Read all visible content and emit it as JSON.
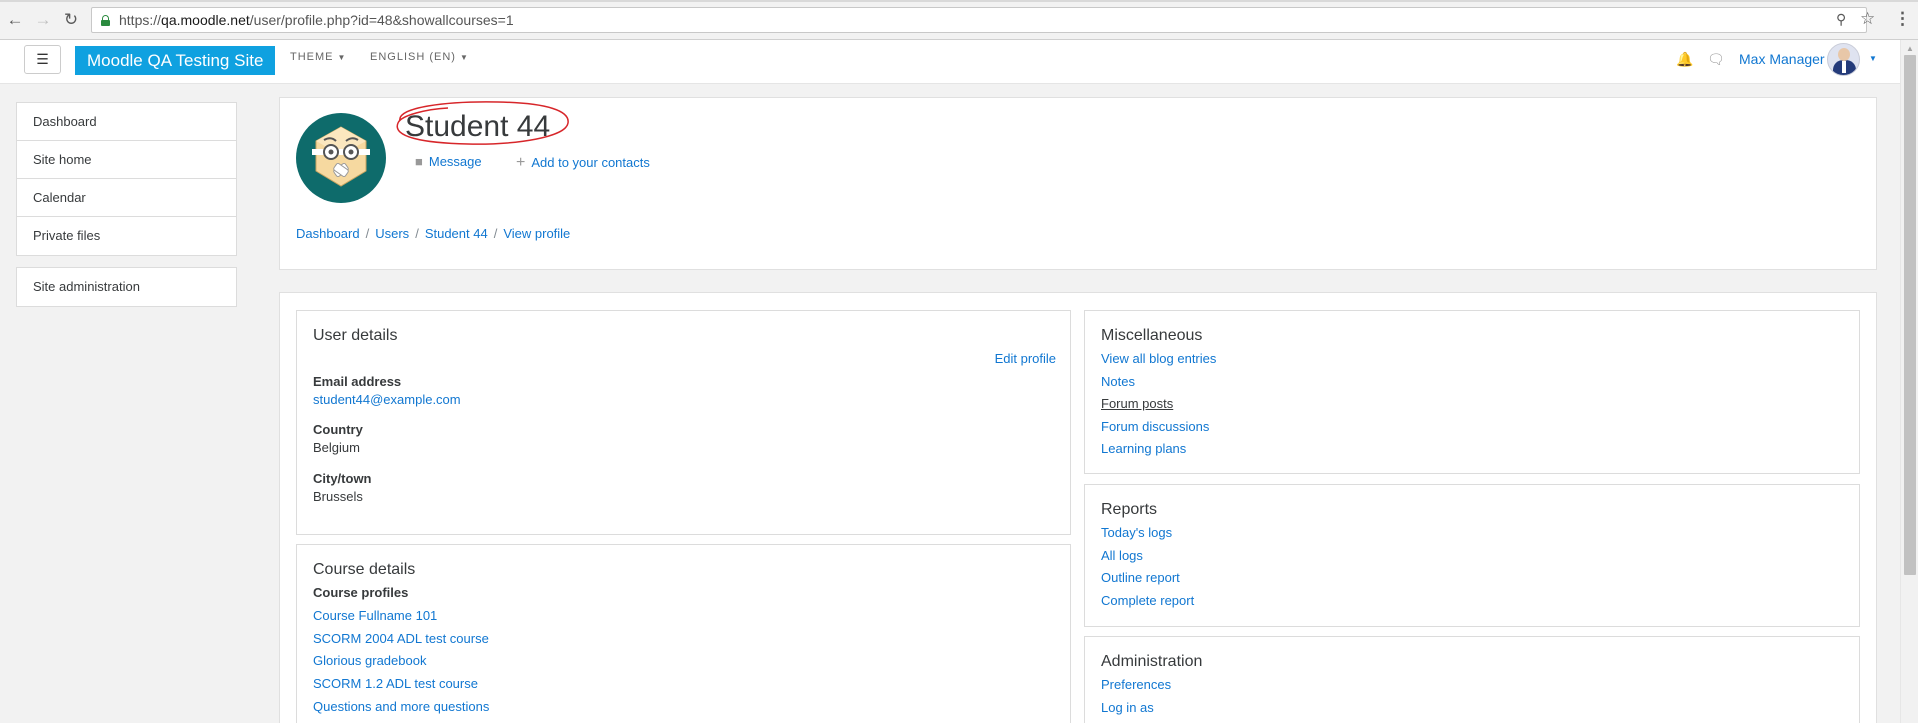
{
  "browser": {
    "url_scheme": "https://",
    "url_host": "qa.moodle.net",
    "url_path": "/user/profile.php?id=48&showallcourses=1"
  },
  "navbar": {
    "drawer_toggle": "☰",
    "site_name": "Moodle QA Testing Site",
    "theme_label": "THEME",
    "language_label": "ENGLISH (EN)",
    "user_name": "Max Manager"
  },
  "sidebar": {
    "items": [
      {
        "label": "Dashboard"
      },
      {
        "label": "Site home"
      },
      {
        "label": "Calendar"
      },
      {
        "label": "Private files"
      }
    ],
    "admin_label": "Site administration"
  },
  "header": {
    "title": "Student 44",
    "message_label": "Message",
    "add_contact_label": "Add to your contacts",
    "breadcrumb": [
      "Dashboard",
      "Users",
      "Student 44",
      "View profile"
    ]
  },
  "user_details": {
    "heading": "User details",
    "edit_profile": "Edit profile",
    "email_label": "Email address",
    "email_value": "student44@example.com",
    "country_label": "Country",
    "country_value": "Belgium",
    "city_label": "City/town",
    "city_value": "Brussels"
  },
  "course_details": {
    "heading": "Course details",
    "subheading": "Course profiles",
    "courses": [
      "Course Fullname 101",
      "SCORM 2004 ADL test course",
      "Glorious gradebook",
      "SCORM 1.2 ADL test course",
      "Questions and more questions"
    ]
  },
  "miscellaneous": {
    "heading": "Miscellaneous",
    "links": [
      "View all blog entries",
      "Notes",
      "Forum posts",
      "Forum discussions",
      "Learning plans"
    ]
  },
  "reports": {
    "heading": "Reports",
    "links": [
      "Today's logs",
      "All logs",
      "Outline report",
      "Complete report"
    ]
  },
  "administration": {
    "heading": "Administration",
    "links": [
      "Preferences",
      "Log in as"
    ]
  },
  "colors": {
    "brand": "#0fa1e0",
    "link": "#1177d1",
    "annotation": "#d7262a"
  }
}
